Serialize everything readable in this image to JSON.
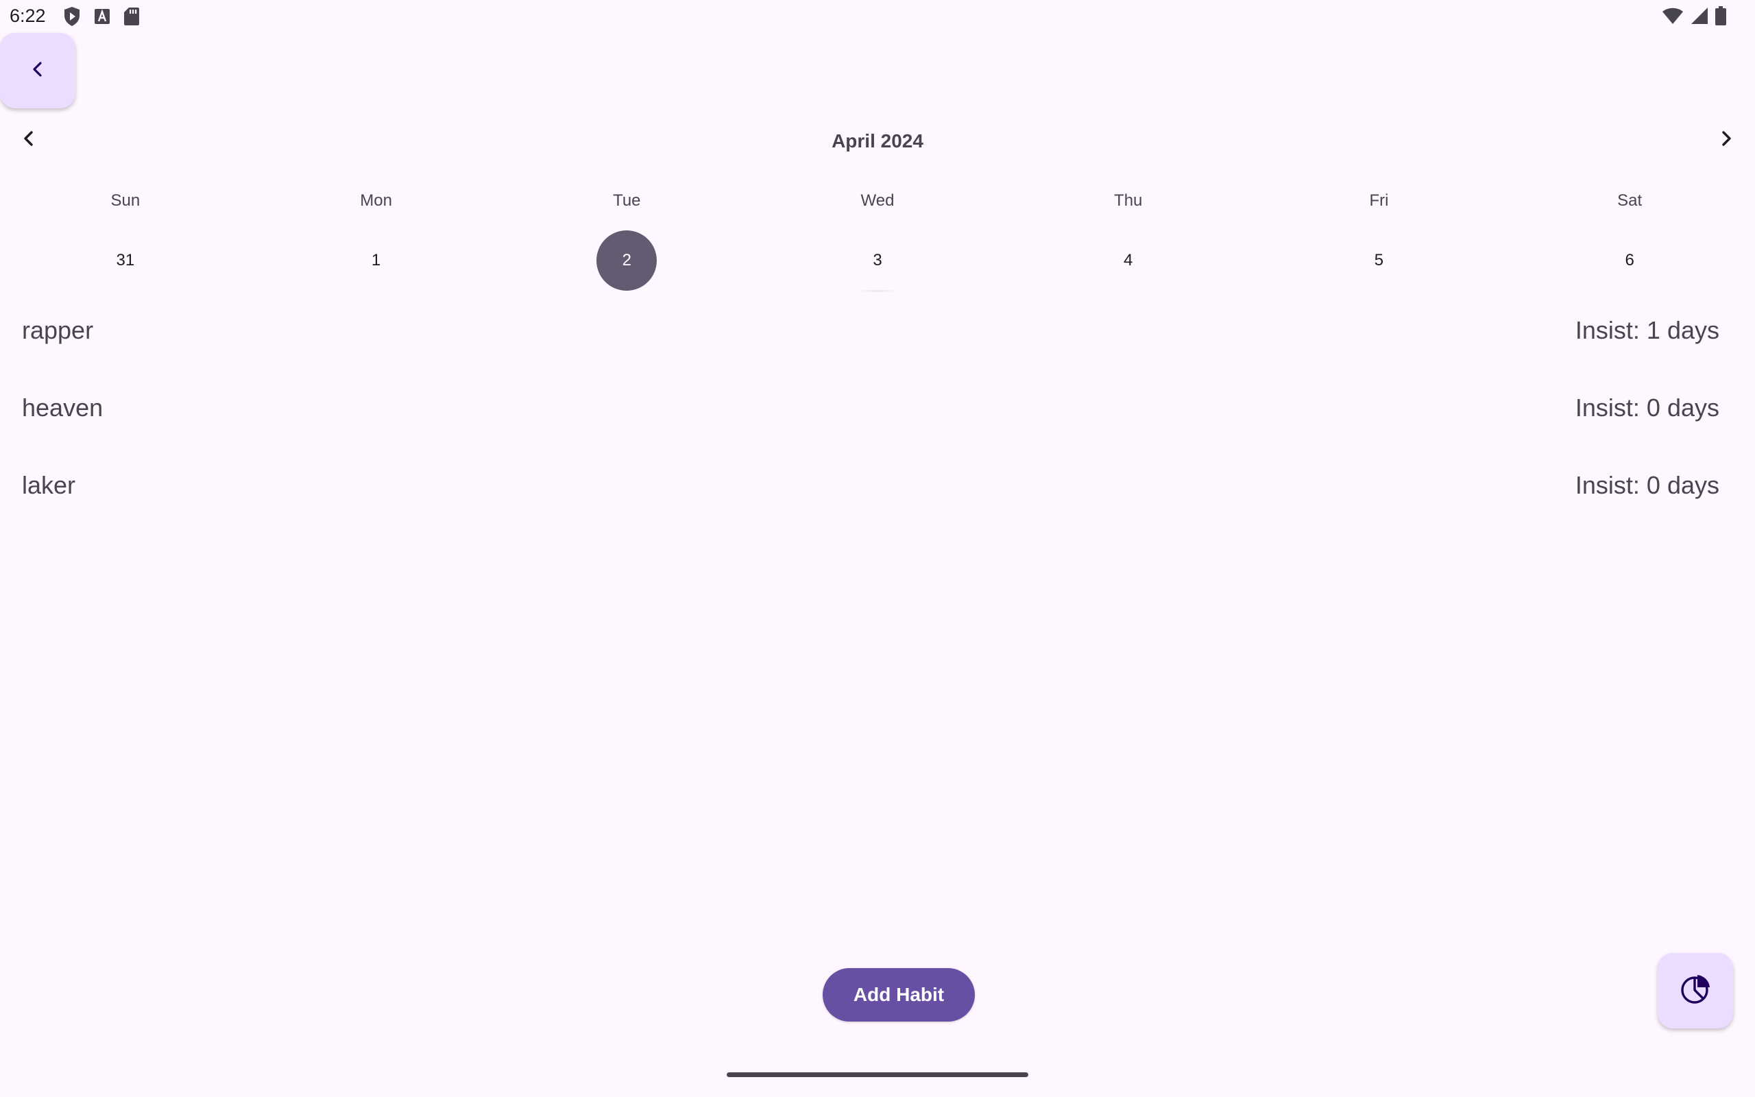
{
  "status_bar": {
    "time": "6:22",
    "left_icons": [
      "shield-play-icon",
      "text-a-icon",
      "sd-card-icon"
    ],
    "right_icons": [
      "wifi-icon",
      "cell-signal-icon",
      "battery-icon"
    ]
  },
  "nav": {
    "back_icon": "chevron-left-icon"
  },
  "calendar": {
    "title": "April 2024",
    "prev_icon": "chevron-left-icon",
    "next_icon": "chevron-right-icon",
    "weekdays": [
      "Sun",
      "Mon",
      "Tue",
      "Wed",
      "Thu",
      "Fri",
      "Sat"
    ],
    "dates": [
      "31",
      "1",
      "2",
      "3",
      "4",
      "5",
      "6"
    ],
    "selected_date": "2",
    "selected_color": "#625b71"
  },
  "habits": [
    {
      "name": "rapper",
      "insist": "Insist: 1 days"
    },
    {
      "name": "heaven",
      "insist": "Insist: 0 days"
    },
    {
      "name": "laker",
      "insist": "Insist: 0 days"
    }
  ],
  "actions": {
    "add_habit_label": "Add Habit",
    "stats_icon": "pie-chart-icon"
  },
  "colors": {
    "background": "#fef7ff",
    "primary": "#6750a4",
    "primary_container": "#eaddff",
    "on_surface_variant": "#49454f"
  }
}
